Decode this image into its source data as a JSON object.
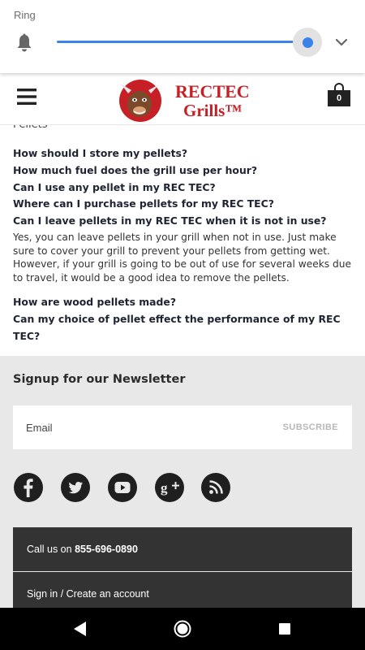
{
  "volume_panel": {
    "title": "Ring",
    "level": 0.95,
    "accent_color": "#3b82e8",
    "icons": {
      "bell": "bell-icon",
      "expand": "chevron-down-icon"
    }
  },
  "header": {
    "logo_line1": "RECTEC",
    "logo_line2": "Grills™",
    "cart_count": "0",
    "icons": {
      "menu": "menu-icon",
      "cart": "shopping-bag-icon"
    }
  },
  "content": {
    "section_label": "Pellets",
    "questions": [
      {
        "q": "How should I store my pellets?"
      },
      {
        "q": "How much fuel does the grill use per hour?"
      },
      {
        "q": "Can I use any pellet in my REC TEC?"
      },
      {
        "q": "Where can I purchase pellets for my REC TEC?"
      },
      {
        "q": "Can I leave pellets in my REC TEC when it is not in use?",
        "answer": "Yes, you can leave pellets in your grill when not in use. Just make sure to cover your grill to prevent your pellets from getting wet. However, if your grill is going to be out of use for several weeks due to travel, it would be a good idea to remove the pellets."
      },
      {
        "q": "How are wood pellets made?"
      },
      {
        "q": "Can my choice of pellet effect the performance of my REC TEC?"
      }
    ]
  },
  "footer": {
    "newsletter_title": "Signup for our Newsletter",
    "email_placeholder": "Email",
    "subscribe_label": "SUBSCRIBE",
    "social": [
      "facebook-icon",
      "twitter-icon",
      "youtube-icon",
      "google-plus-icon",
      "rss-icon"
    ],
    "call_prefix": "Call us on ",
    "phone": "855-696-0890",
    "signin_label": "Sign in / Create an account"
  },
  "navbar": {
    "icons": [
      "back-icon",
      "home-icon",
      "recents-icon"
    ]
  }
}
